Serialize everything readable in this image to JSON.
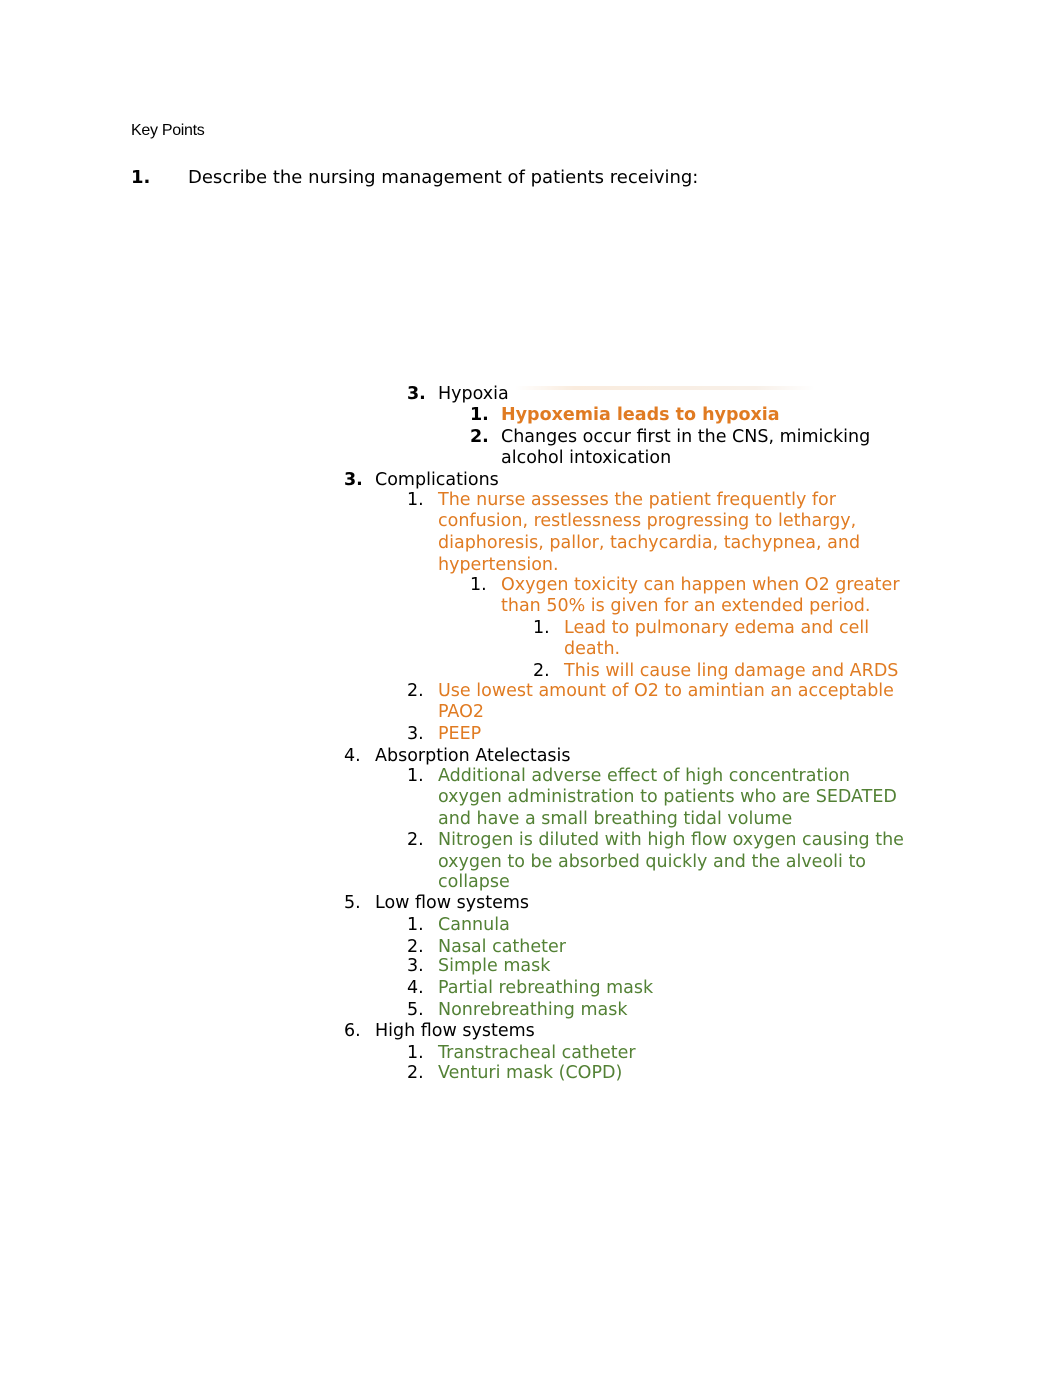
{
  "document": {
    "heading": "Key Points",
    "question": {
      "number": "1.",
      "text": "Describe the nursing management of patients receiving:"
    },
    "colors": {
      "orange": "#E07B22",
      "green": "#538135",
      "black": "#000000"
    },
    "lines": [
      {
        "num": "3.",
        "text": "Hypoxia"
      },
      {
        "num": "1.",
        "text": "Hypoxemia leads to hypoxia"
      },
      {
        "num": "2.",
        "text": "Changes occur first in the CNS, mimicking"
      },
      {
        "text": "alcohol intoxication"
      },
      {
        "num": "3.",
        "text": "Complications"
      },
      {
        "num": "1.",
        "text": "The nurse assesses the patient frequently for"
      },
      {
        "text": "confusion, restlessness progressing to lethargy,"
      },
      {
        "text": "diaphoresis, pallor, tachycardia, tachypnea, and"
      },
      {
        "text": "hypertension."
      },
      {
        "num": "1.",
        "text": "Oxygen toxicity can happen when O2 greater"
      },
      {
        "text": "than 50% is given for an extended period."
      },
      {
        "num": "1.",
        "text": "Lead to pulmonary edema and cell"
      },
      {
        "text": "death."
      },
      {
        "num": "2.",
        "text": "This will cause ling damage and ARDS"
      },
      {
        "num": "2.",
        "text": "Use lowest amount of O2 to amintian an acceptable"
      },
      {
        "text": "PAO2"
      },
      {
        "num": "3.",
        "text": "PEEP"
      },
      {
        "num": "4.",
        "text": "Absorption Atelectasis"
      },
      {
        "num": "1.",
        "text": "Additional adverse effect of high concentration"
      },
      {
        "text": "oxygen administration to patients who are SEDATED"
      },
      {
        "text": "and have a small breathing tidal volume"
      },
      {
        "num": "2.",
        "text": "Nitrogen is diluted with high flow oxygen causing the"
      },
      {
        "text": "oxygen to be absorbed quickly and the alveoli to"
      },
      {
        "text": "collapse"
      },
      {
        "num": "5.",
        "text": "Low flow systems"
      },
      {
        "num": "1.",
        "text": "Cannula"
      },
      {
        "num": "2.",
        "text": "Nasal catheter"
      },
      {
        "num": "3.",
        "text": "Simple mask"
      },
      {
        "num": "4.",
        "text": "Partial rebreathing mask"
      },
      {
        "num": "5.",
        "text": "Nonrebreathing mask"
      },
      {
        "num": "6.",
        "text": "High flow systems"
      },
      {
        "num": "1.",
        "text": "Transtracheal catheter"
      },
      {
        "num": "2.",
        "text": "Venturi mask (COPD)"
      }
    ]
  }
}
